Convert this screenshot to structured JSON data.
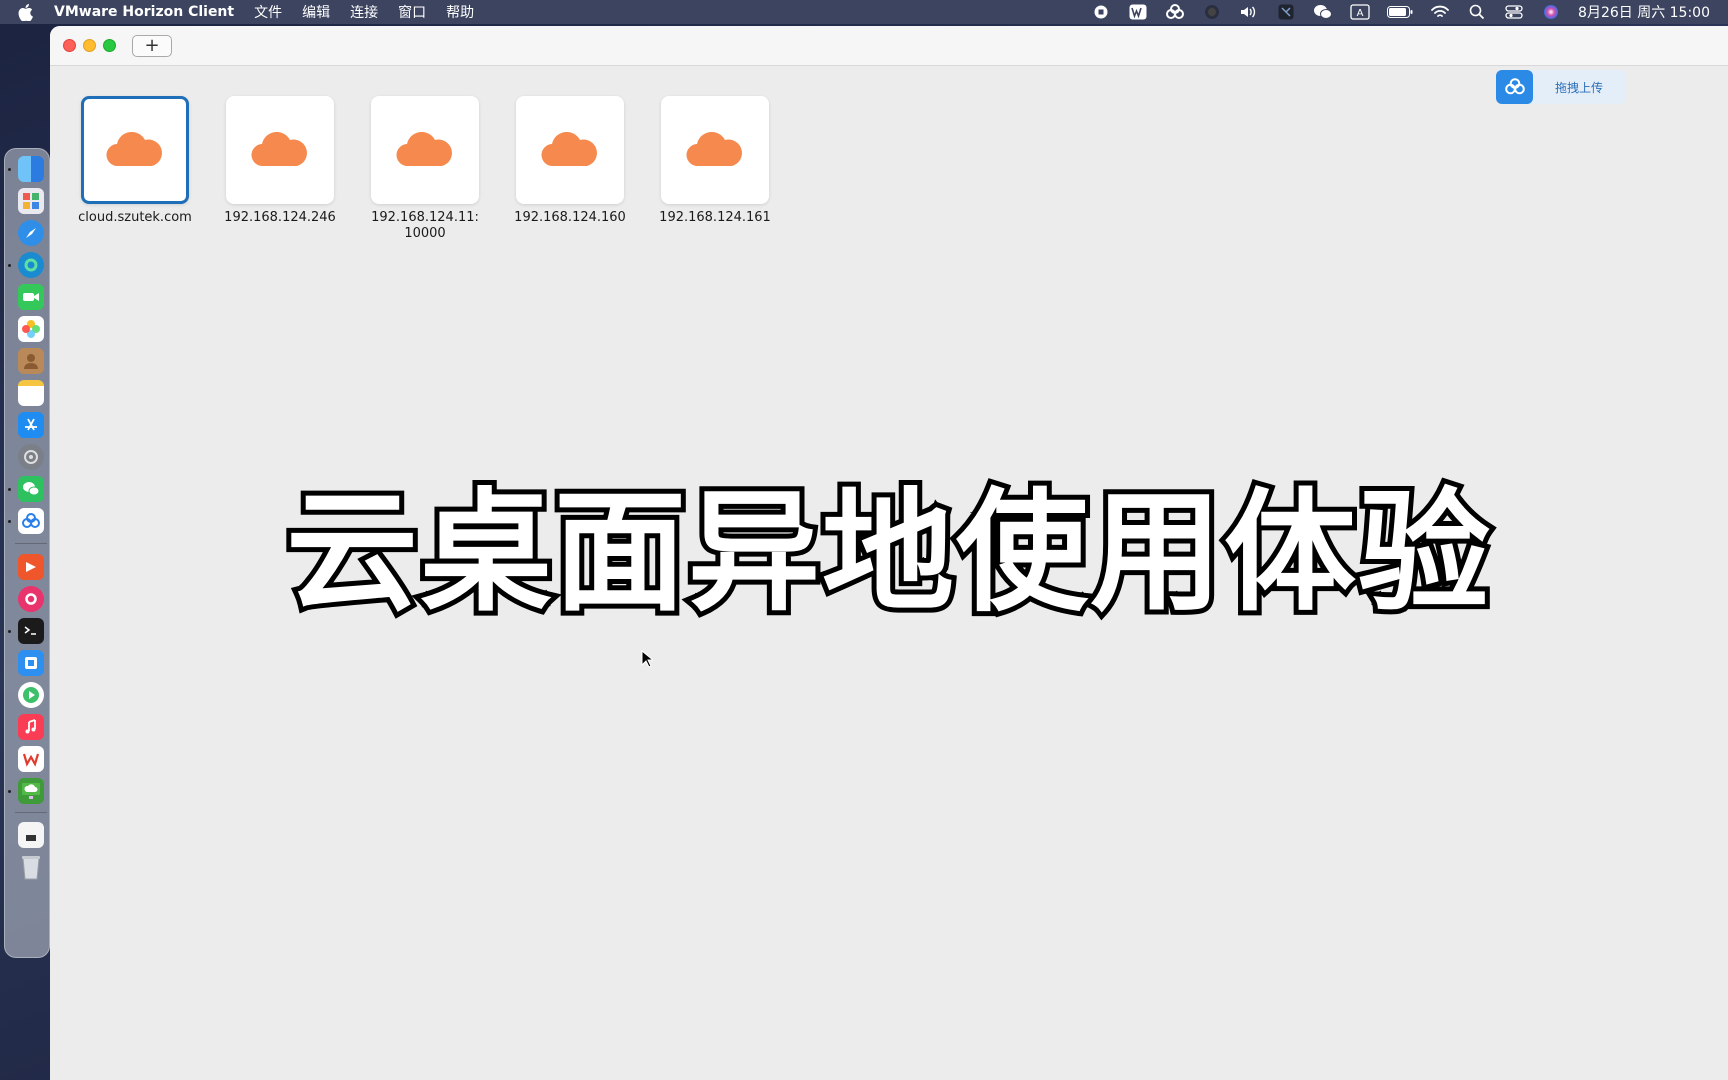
{
  "menubar": {
    "app_name": "VMware Horizon Client",
    "menus": [
      "文件",
      "编辑",
      "连接",
      "窗口",
      "帮助"
    ],
    "status_icons": [
      "record-icon",
      "wps-icon",
      "baidunetdisk-icon",
      "siri-dot-icon",
      "volume-icon",
      "app-icon",
      "wechat-icon",
      "input-method-icon",
      "battery-icon",
      "wifi-icon",
      "spotlight-icon",
      "control-center-icon",
      "siri-icon"
    ],
    "input_method": "A",
    "clock": "8月26日 周六 15:00"
  },
  "toolbar": {
    "add_label": "+"
  },
  "servers": [
    {
      "label": "cloud.szutek.com",
      "selected": true
    },
    {
      "label": "192.168.124.246",
      "selected": false
    },
    {
      "label": "192.168.124.11:10000",
      "selected": false
    },
    {
      "label": "192.168.124.160",
      "selected": false
    },
    {
      "label": "192.168.124.161",
      "selected": false
    }
  ],
  "upload_widget": {
    "label": "拖拽上传"
  },
  "caption": "云桌面异地使用体验",
  "colors": {
    "cloud": "#f6894e",
    "selection": "#1f6fb8",
    "accent": "#2b8ae6"
  },
  "dock": {
    "items": [
      "finder-icon",
      "launchpad-icon",
      "safari-icon",
      "edge-icon",
      "facetime-icon",
      "photos-icon",
      "contacts-icon",
      "notes-icon",
      "app-store-icon",
      "system-settings-icon",
      "wechat-icon",
      "baidunetdisk-icon",
      "keynote-icon",
      "app-icon",
      "terminal-icon",
      "app-icon",
      "video-icon",
      "music-icon",
      "wps-icon",
      "horizon-client-icon",
      "document-icon",
      "trash-icon"
    ]
  }
}
